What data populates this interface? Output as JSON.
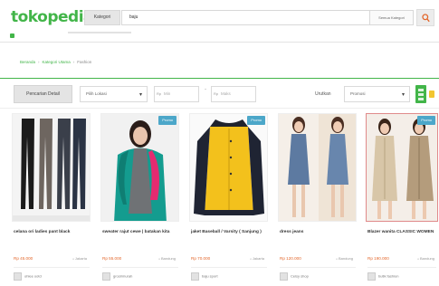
{
  "header": {
    "logo": "tokopedia",
    "kategori_label": "Kategori",
    "search_value": "baju",
    "search_category": "Semua Kategori",
    "search_icon": "magnifier-icon"
  },
  "breadcrumb": {
    "items": [
      "Beranda",
      "Kategori Utama",
      "Fashion"
    ]
  },
  "toolbar": {
    "filter_button": "Pencarian Detail",
    "location_select": "Pilih Lokasi",
    "price_min_prefix": "Rp",
    "price_min_placeholder": "Min",
    "price_max_prefix": "Rp",
    "price_max_placeholder": "Maks",
    "price_separator": "-",
    "sort_label": "Urutkan",
    "sort_select": "Promosi",
    "caret_glyph": "▾",
    "grid_icon": "grid-view-icon",
    "list_icon": "list-view-icon",
    "accent_color": "#42b549"
  },
  "products": [
    {
      "name": "celana ori ladies pant black",
      "price": "Rp 45.000",
      "location": "Jakarta",
      "shop": "ohlee ootd",
      "badge": ""
    },
    {
      "name": "sweater rajut cewe | batakan kita",
      "price": "Rp 55.000",
      "location": "Bandung",
      "shop": "grosirmurah",
      "badge": "Promo"
    },
    {
      "name": "jaket Baseball / Varsity ( Sanjung )",
      "price": "Rp 70.000",
      "location": "Jakarta",
      "shop": "baju sport",
      "badge": "Promo"
    },
    {
      "name": "dress jeans",
      "price": "Rp 120.000",
      "location": "Bandung",
      "shop": "Celsy shop",
      "badge": ""
    },
    {
      "name": "Blazer wanita CLASSIC WOMEN",
      "price": "Rp 190.000",
      "location": "Bandung",
      "shop": "butik fashion",
      "badge": "Promo"
    }
  ],
  "colors": {
    "brand_green": "#42b549",
    "price_orange": "#e3672b",
    "badge_blue": "#4ca7c9"
  }
}
